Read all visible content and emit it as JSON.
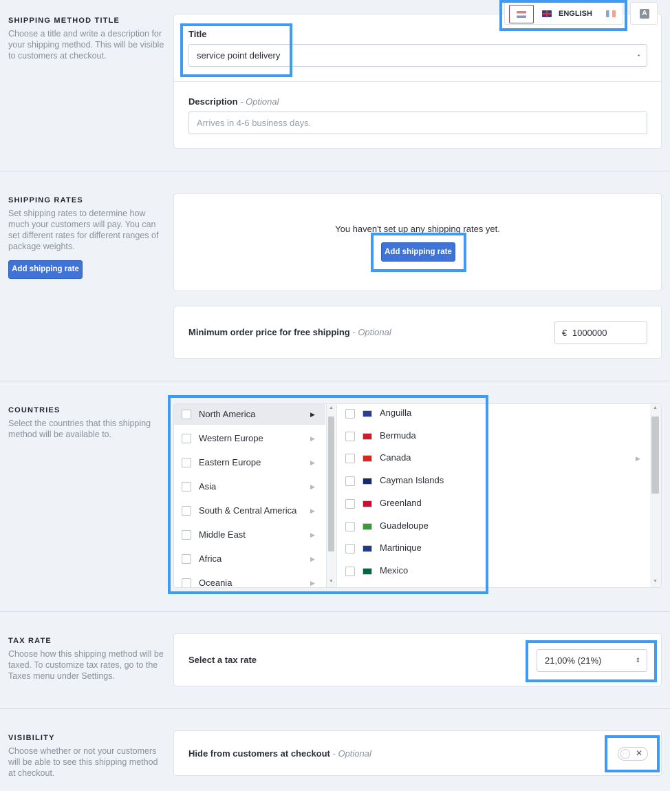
{
  "title_section": {
    "heading": "SHIPPING METHOD TITLE",
    "description": "Choose a title and write a description for your shipping method. This will be visible to customers at checkout.",
    "title_label": "Title",
    "title_value": "service point delivery",
    "description_label": "Description",
    "description_optional": "- Optional",
    "description_placeholder": "Arrives in 4-6 business days."
  },
  "language_bar": {
    "selected": "ENGLISH",
    "translate_icon_label": "A"
  },
  "rates_section": {
    "heading": "SHIPPING RATES",
    "description": "Set shipping rates to determine how much your customers will pay. You can set different rates for different ranges of package weights.",
    "side_button": "Add shipping rate",
    "empty_text": "You haven't set up any shipping rates yet.",
    "card_button": "Add shipping rate",
    "free_label": "Minimum order price for free shipping",
    "free_optional": "- Optional",
    "free_currency": "€",
    "free_value": "1000000"
  },
  "countries_section": {
    "heading": "COUNTRIES",
    "description": "Select the countries that this shipping method will be available to.",
    "regions": [
      "North America",
      "Western Europe",
      "Eastern Europe",
      "Asia",
      "South & Central America",
      "Middle East",
      "Africa",
      "Oceania"
    ],
    "countries": [
      {
        "name": "Anguilla",
        "flag_color": "#2a3f8f"
      },
      {
        "name": "Bermuda",
        "flag_color": "#c8202f"
      },
      {
        "name": "Canada",
        "flag_color": "#d52b1e"
      },
      {
        "name": "Cayman Islands",
        "flag_color": "#1b2a6b"
      },
      {
        "name": "Greenland",
        "flag_color": "#d00c33"
      },
      {
        "name": "Guadeloupe",
        "flag_color": "#3a9b3a"
      },
      {
        "name": "Martinique",
        "flag_color": "#1f3a8a"
      },
      {
        "name": "Mexico",
        "flag_color": "#006847"
      }
    ]
  },
  "tax_section": {
    "heading": "TAX RATE",
    "description": "Choose how this shipping method will be taxed. To customize tax rates, go to the Taxes menu under Settings.",
    "label": "Select a tax rate",
    "value": "21,00% (21%)"
  },
  "visibility_section": {
    "heading": "VISIBILITY",
    "description": "Choose whether or not your customers will be able to see this shipping method at checkout.",
    "label": "Hide from customers at checkout",
    "optional": "- Optional"
  },
  "colors": {
    "accent": "#3f73d6",
    "highlight": "#3d9bf5",
    "background": "#eff2f6"
  }
}
